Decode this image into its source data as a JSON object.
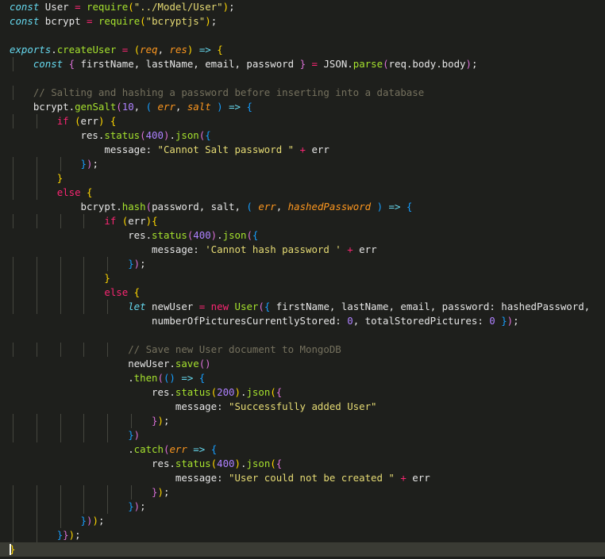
{
  "editor": {
    "language": "javascript",
    "theme_colors": {
      "background": "#1e1f1c",
      "keyword": "#66d9ef",
      "control": "#f92672",
      "string": "#e6db74",
      "number": "#ae81ff",
      "function": "#a6e22e",
      "parameter": "#fd971f",
      "comment": "#75715e"
    },
    "lines": [
      [
        [
          "kw",
          "const"
        ],
        [
          "id",
          " User "
        ],
        [
          "op",
          "="
        ],
        [
          "id",
          " "
        ],
        [
          "fn",
          "require"
        ],
        [
          "br1",
          "("
        ],
        [
          "str",
          "\"../Model/User\""
        ],
        [
          "br1",
          ")"
        ],
        [
          "id",
          ";"
        ]
      ],
      [
        [
          "kw",
          "const"
        ],
        [
          "id",
          " bcrypt "
        ],
        [
          "op",
          "="
        ],
        [
          "id",
          " "
        ],
        [
          "fn",
          "require"
        ],
        [
          "br1",
          "("
        ],
        [
          "str",
          "\"bcryptjs\""
        ],
        [
          "br1",
          ")"
        ],
        [
          "id",
          ";"
        ]
      ],
      [],
      [
        [
          "ex",
          "exports"
        ],
        [
          "id",
          "."
        ],
        [
          "fn",
          "createUser"
        ],
        [
          "id",
          " "
        ],
        [
          "op",
          "="
        ],
        [
          "id",
          " "
        ],
        [
          "br1",
          "("
        ],
        [
          "prm",
          "req"
        ],
        [
          "id",
          ", "
        ],
        [
          "prm",
          "res"
        ],
        [
          "br1",
          ")"
        ],
        [
          "id",
          " "
        ],
        [
          "kw",
          "=>"
        ],
        [
          "id",
          " "
        ],
        [
          "br1",
          "{"
        ]
      ],
      [
        [
          "id",
          "    "
        ],
        [
          "kw",
          "const"
        ],
        [
          "id",
          " "
        ],
        [
          "br2",
          "{"
        ],
        [
          "id",
          " firstName, lastName, email, password "
        ],
        [
          "br2",
          "}"
        ],
        [
          "id",
          " "
        ],
        [
          "op",
          "="
        ],
        [
          "id",
          " JSON."
        ],
        [
          "fn",
          "parse"
        ],
        [
          "br2",
          "("
        ],
        [
          "id",
          "req.body.body"
        ],
        [
          "br2",
          ")"
        ],
        [
          "id",
          ";"
        ]
      ],
      [],
      [
        [
          "id",
          "    "
        ],
        [
          "cmt",
          "// Salting and hashing a password before inserting into a database"
        ]
      ],
      [
        [
          "id",
          "    bcrypt."
        ],
        [
          "fn",
          "genSalt"
        ],
        [
          "br2",
          "("
        ],
        [
          "num",
          "10"
        ],
        [
          "id",
          ", "
        ],
        [
          "br3",
          "("
        ],
        [
          "id",
          " "
        ],
        [
          "prm",
          "err"
        ],
        [
          "id",
          ", "
        ],
        [
          "prm",
          "salt"
        ],
        [
          "id",
          " "
        ],
        [
          "br3",
          ")"
        ],
        [
          "id",
          " "
        ],
        [
          "kw",
          "=>"
        ],
        [
          "id",
          " "
        ],
        [
          "br3",
          "{"
        ]
      ],
      [
        [
          "id",
          "        "
        ],
        [
          "ctl",
          "if"
        ],
        [
          "id",
          " "
        ],
        [
          "br1",
          "("
        ],
        [
          "id",
          "err"
        ],
        [
          "br1",
          ")"
        ],
        [
          "id",
          " "
        ],
        [
          "br1",
          "{"
        ]
      ],
      [
        [
          "id",
          "            res."
        ],
        [
          "fn",
          "status"
        ],
        [
          "br2",
          "("
        ],
        [
          "num",
          "400"
        ],
        [
          "br2",
          ")"
        ],
        [
          "id",
          "."
        ],
        [
          "fn",
          "json"
        ],
        [
          "br2",
          "("
        ],
        [
          "br3",
          "{"
        ]
      ],
      [
        [
          "id",
          "                message: "
        ],
        [
          "str",
          "\"Cannot Salt password \""
        ],
        [
          "id",
          " "
        ],
        [
          "op",
          "+"
        ],
        [
          "id",
          " err"
        ]
      ],
      [
        [
          "id",
          "            "
        ],
        [
          "br3",
          "}"
        ],
        [
          "br2",
          ")"
        ],
        [
          "id",
          ";"
        ]
      ],
      [
        [
          "id",
          "        "
        ],
        [
          "br1",
          "}"
        ]
      ],
      [
        [
          "id",
          "        "
        ],
        [
          "ctl",
          "else"
        ],
        [
          "id",
          " "
        ],
        [
          "br1",
          "{"
        ]
      ],
      [
        [
          "id",
          "            bcrypt."
        ],
        [
          "fn",
          "hash"
        ],
        [
          "br2",
          "("
        ],
        [
          "id",
          "password, salt, "
        ],
        [
          "br3",
          "("
        ],
        [
          "id",
          " "
        ],
        [
          "prm",
          "err"
        ],
        [
          "id",
          ", "
        ],
        [
          "prm",
          "hashedPassword"
        ],
        [
          "id",
          " "
        ],
        [
          "br3",
          ")"
        ],
        [
          "id",
          " "
        ],
        [
          "kw",
          "=>"
        ],
        [
          "id",
          " "
        ],
        [
          "br3",
          "{"
        ]
      ],
      [
        [
          "id",
          "                "
        ],
        [
          "ctl",
          "if"
        ],
        [
          "id",
          " "
        ],
        [
          "br1",
          "("
        ],
        [
          "id",
          "err"
        ],
        [
          "br1",
          ")"
        ],
        [
          "br1",
          "{"
        ]
      ],
      [
        [
          "id",
          "                    res."
        ],
        [
          "fn",
          "status"
        ],
        [
          "br2",
          "("
        ],
        [
          "num",
          "400"
        ],
        [
          "br2",
          ")"
        ],
        [
          "id",
          "."
        ],
        [
          "fn",
          "json"
        ],
        [
          "br2",
          "("
        ],
        [
          "br3",
          "{"
        ]
      ],
      [
        [
          "id",
          "                        message: "
        ],
        [
          "str",
          "'Cannot hash password '"
        ],
        [
          "id",
          " "
        ],
        [
          "op",
          "+"
        ],
        [
          "id",
          " err"
        ]
      ],
      [
        [
          "id",
          "                    "
        ],
        [
          "br3",
          "}"
        ],
        [
          "br2",
          ")"
        ],
        [
          "id",
          ";"
        ]
      ],
      [
        [
          "id",
          "                "
        ],
        [
          "br1",
          "}"
        ]
      ],
      [
        [
          "id",
          "                "
        ],
        [
          "ctl",
          "else"
        ],
        [
          "id",
          " "
        ],
        [
          "br1",
          "{"
        ]
      ],
      [
        [
          "id",
          "                    "
        ],
        [
          "kw",
          "let"
        ],
        [
          "id",
          " newUser "
        ],
        [
          "op",
          "="
        ],
        [
          "id",
          " "
        ],
        [
          "ctl",
          "new"
        ],
        [
          "id",
          " "
        ],
        [
          "fn",
          "User"
        ],
        [
          "br2",
          "("
        ],
        [
          "br3",
          "{"
        ],
        [
          "id",
          " firstName, lastName, email, password: hashedPassword,"
        ]
      ],
      [
        [
          "id",
          "                        numberOfPicturesCurrentlyStored: "
        ],
        [
          "num",
          "0"
        ],
        [
          "id",
          ", totalStoredPictures: "
        ],
        [
          "num",
          "0"
        ],
        [
          "id",
          " "
        ],
        [
          "br3",
          "}"
        ],
        [
          "br2",
          ")"
        ],
        [
          "id",
          ";"
        ]
      ],
      [],
      [
        [
          "id",
          "                    "
        ],
        [
          "cmt",
          "// Save new User document to MongoDB"
        ]
      ],
      [
        [
          "id",
          "                    newUser."
        ],
        [
          "fn",
          "save"
        ],
        [
          "br2",
          "()"
        ]
      ],
      [
        [
          "id",
          "                    ."
        ],
        [
          "fn",
          "then"
        ],
        [
          "br2",
          "("
        ],
        [
          "br3",
          "()"
        ],
        [
          "id",
          " "
        ],
        [
          "kw",
          "=>"
        ],
        [
          "id",
          " "
        ],
        [
          "br3",
          "{"
        ]
      ],
      [
        [
          "id",
          "                        res."
        ],
        [
          "fn",
          "status"
        ],
        [
          "br1",
          "("
        ],
        [
          "num",
          "200"
        ],
        [
          "br1",
          ")"
        ],
        [
          "id",
          "."
        ],
        [
          "fn",
          "json"
        ],
        [
          "br1",
          "("
        ],
        [
          "br2",
          "{"
        ]
      ],
      [
        [
          "id",
          "                            message: "
        ],
        [
          "str",
          "\"Successfully added User\""
        ]
      ],
      [
        [
          "id",
          "                        "
        ],
        [
          "br2",
          "}"
        ],
        [
          "br1",
          ")"
        ],
        [
          "id",
          ";"
        ]
      ],
      [
        [
          "id",
          "                    "
        ],
        [
          "br3",
          "}"
        ],
        [
          "br2",
          ")"
        ]
      ],
      [
        [
          "id",
          "                    ."
        ],
        [
          "fn",
          "catch"
        ],
        [
          "br2",
          "("
        ],
        [
          "prm",
          "err"
        ],
        [
          "id",
          " "
        ],
        [
          "kw",
          "=>"
        ],
        [
          "id",
          " "
        ],
        [
          "br3",
          "{"
        ]
      ],
      [
        [
          "id",
          "                        res."
        ],
        [
          "fn",
          "status"
        ],
        [
          "br1",
          "("
        ],
        [
          "num",
          "400"
        ],
        [
          "br1",
          ")"
        ],
        [
          "id",
          "."
        ],
        [
          "fn",
          "json"
        ],
        [
          "br1",
          "("
        ],
        [
          "br2",
          "{"
        ]
      ],
      [
        [
          "id",
          "                            message: "
        ],
        [
          "str",
          "\"User could not be created \""
        ],
        [
          "id",
          " "
        ],
        [
          "op",
          "+"
        ],
        [
          "id",
          " err"
        ]
      ],
      [
        [
          "id",
          "                        "
        ],
        [
          "br2",
          "}"
        ],
        [
          "br1",
          ")"
        ],
        [
          "id",
          ";"
        ]
      ],
      [
        [
          "id",
          "                    "
        ],
        [
          "br3",
          "}"
        ],
        [
          "br2",
          ")"
        ],
        [
          "id",
          ";"
        ]
      ],
      [
        [
          "id",
          "            "
        ],
        [
          "br3",
          "}"
        ],
        [
          "br2",
          ")"
        ],
        [
          "br1",
          ")"
        ],
        [
          "id",
          ";"
        ]
      ],
      [
        [
          "id",
          "        "
        ],
        [
          "br3",
          "}"
        ],
        [
          "br2",
          "}"
        ],
        [
          "br1",
          ")"
        ],
        [
          "id",
          ";"
        ]
      ],
      [
        [
          "br1",
          "}"
        ]
      ]
    ],
    "current_line": 38
  }
}
